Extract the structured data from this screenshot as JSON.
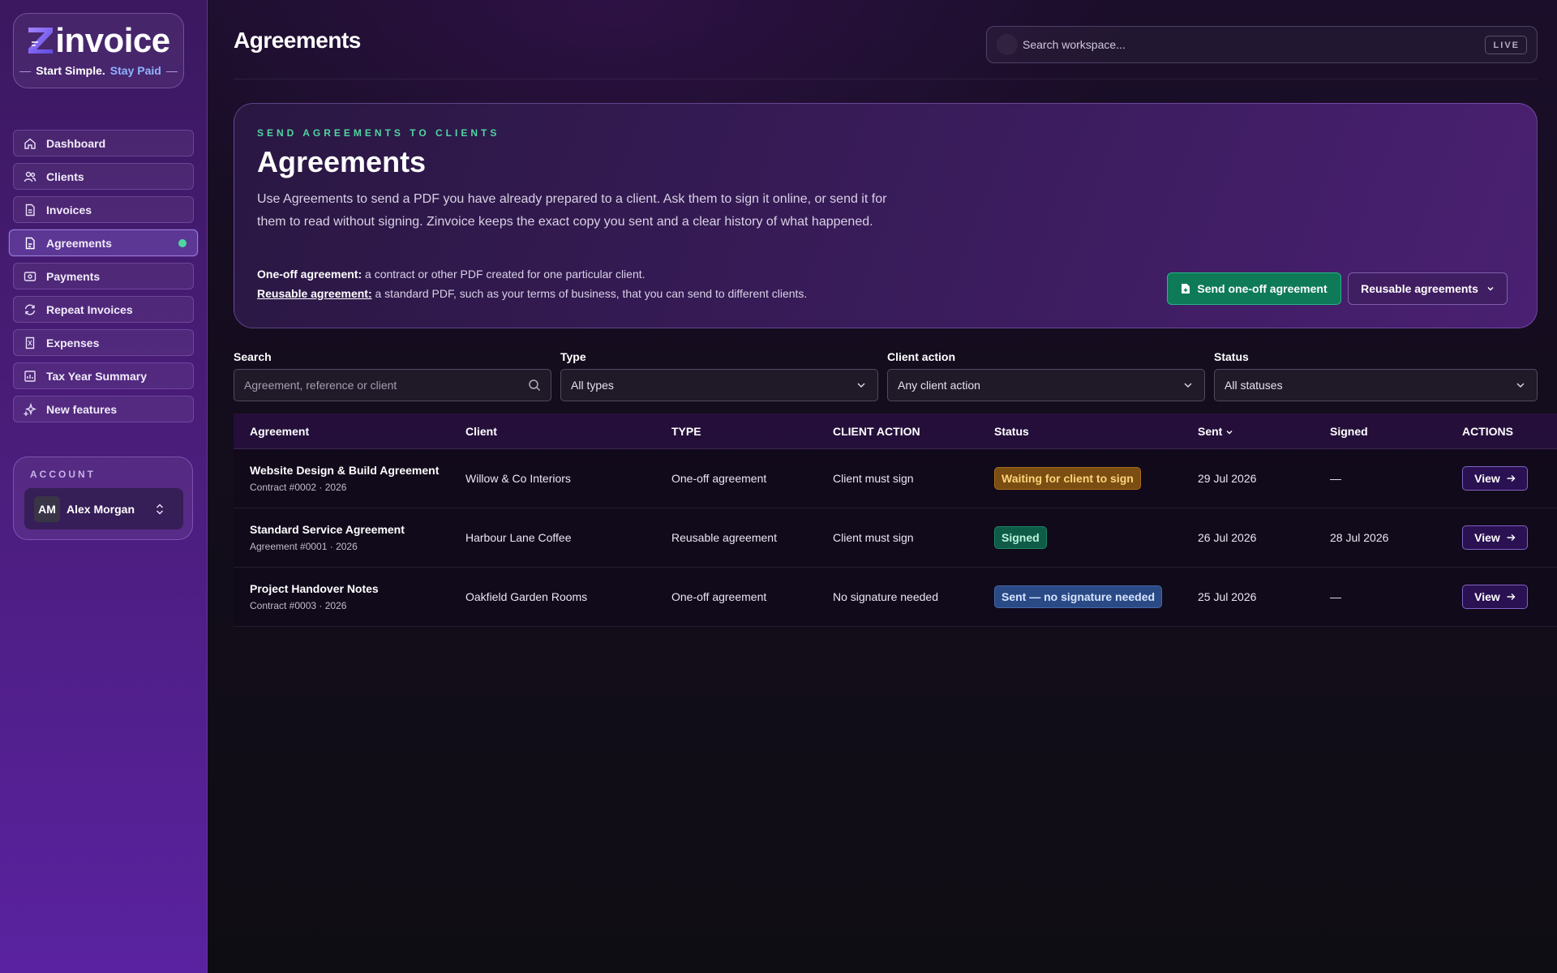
{
  "brand": {
    "name": "invoice",
    "tagline_main": "Start Simple.",
    "tagline_accent": "Stay Paid",
    "dash": "—"
  },
  "sidebar": {
    "items": [
      {
        "label": "Dashboard",
        "icon": "home-icon"
      },
      {
        "label": "Clients",
        "icon": "users-icon"
      },
      {
        "label": "Invoices",
        "icon": "file-icon"
      },
      {
        "label": "Agreements",
        "icon": "document-icon",
        "active": true
      },
      {
        "label": "Payments",
        "icon": "wallet-icon"
      },
      {
        "label": "Repeat Invoices",
        "icon": "repeat-icon"
      },
      {
        "label": "Expenses",
        "icon": "receipt-icon"
      },
      {
        "label": "Tax Year Summary",
        "icon": "chart-icon"
      },
      {
        "label": "New features",
        "icon": "sparkle-icon"
      }
    ]
  },
  "account": {
    "label": "ACCOUNT",
    "initials": "AM",
    "name": "Alex Morgan"
  },
  "header": {
    "title": "Agreements",
    "search_placeholder": "Search workspace...",
    "live_badge": "LIVE"
  },
  "hero": {
    "kicker": "SEND AGREEMENTS TO CLIENTS",
    "title": "Agreements",
    "description": "Use Agreements to send a PDF you have already prepared to a client. Ask them to sign it online, or send it for them to read without signing. Zinvoice keeps the exact copy you sent and a clear history of what happened.",
    "oneoff_term": "One-off agreement:",
    "oneoff_text": " a contract or other PDF created for one particular client.",
    "reusable_term": "Reusable agreement:",
    "reusable_text": " a standard PDF, such as your terms of business, that you can send to different clients.",
    "send_button": "Send one-off agreement",
    "reusable_button": "Reusable agreements"
  },
  "filters": {
    "search_label": "Search",
    "search_placeholder": "Agreement, reference or client",
    "type_label": "Type",
    "type_value": "All types",
    "client_action_label": "Client action",
    "client_action_value": "Any client action",
    "status_label": "Status",
    "status_value": "All statuses"
  },
  "table": {
    "headers": {
      "agreement": "Agreement",
      "client": "Client",
      "type": "TYPE",
      "client_action": "CLIENT ACTION",
      "status": "Status",
      "sent": "Sent",
      "signed": "Signed",
      "actions": "ACTIONS"
    },
    "rows": [
      {
        "name": "Website Design & Build Agreement",
        "ref": "Contract #0002 · 2026",
        "client": "Willow & Co Interiors",
        "type": "One-off agreement",
        "client_action": "Client must sign",
        "status": "Waiting for client to sign",
        "sent": "29 Jul 2026",
        "signed": "—",
        "view": "View"
      },
      {
        "name": "Standard Service Agreement",
        "ref": "Agreement #0001 · 2026",
        "client": "Harbour Lane Coffee",
        "type": "Reusable agreement",
        "client_action": "Client must sign",
        "status": "Signed",
        "sent": "26 Jul 2026",
        "signed": "28 Jul 2026",
        "view": "View"
      },
      {
        "name": "Project Handover Notes",
        "ref": "Contract #0003 · 2026",
        "client": "Oakfield Garden Rooms",
        "type": "One-off agreement",
        "client_action": "No signature needed",
        "status": "Sent — no signature needed",
        "sent": "25 Jul 2026",
        "signed": "—",
        "view": "View"
      }
    ]
  },
  "colors": {
    "accent_green": "#4fd6a0",
    "brand_purple": "#4a1d7a",
    "waiting": "#7a4d12",
    "signed": "#0e5b47",
    "no_signature": "#2a4a86"
  }
}
